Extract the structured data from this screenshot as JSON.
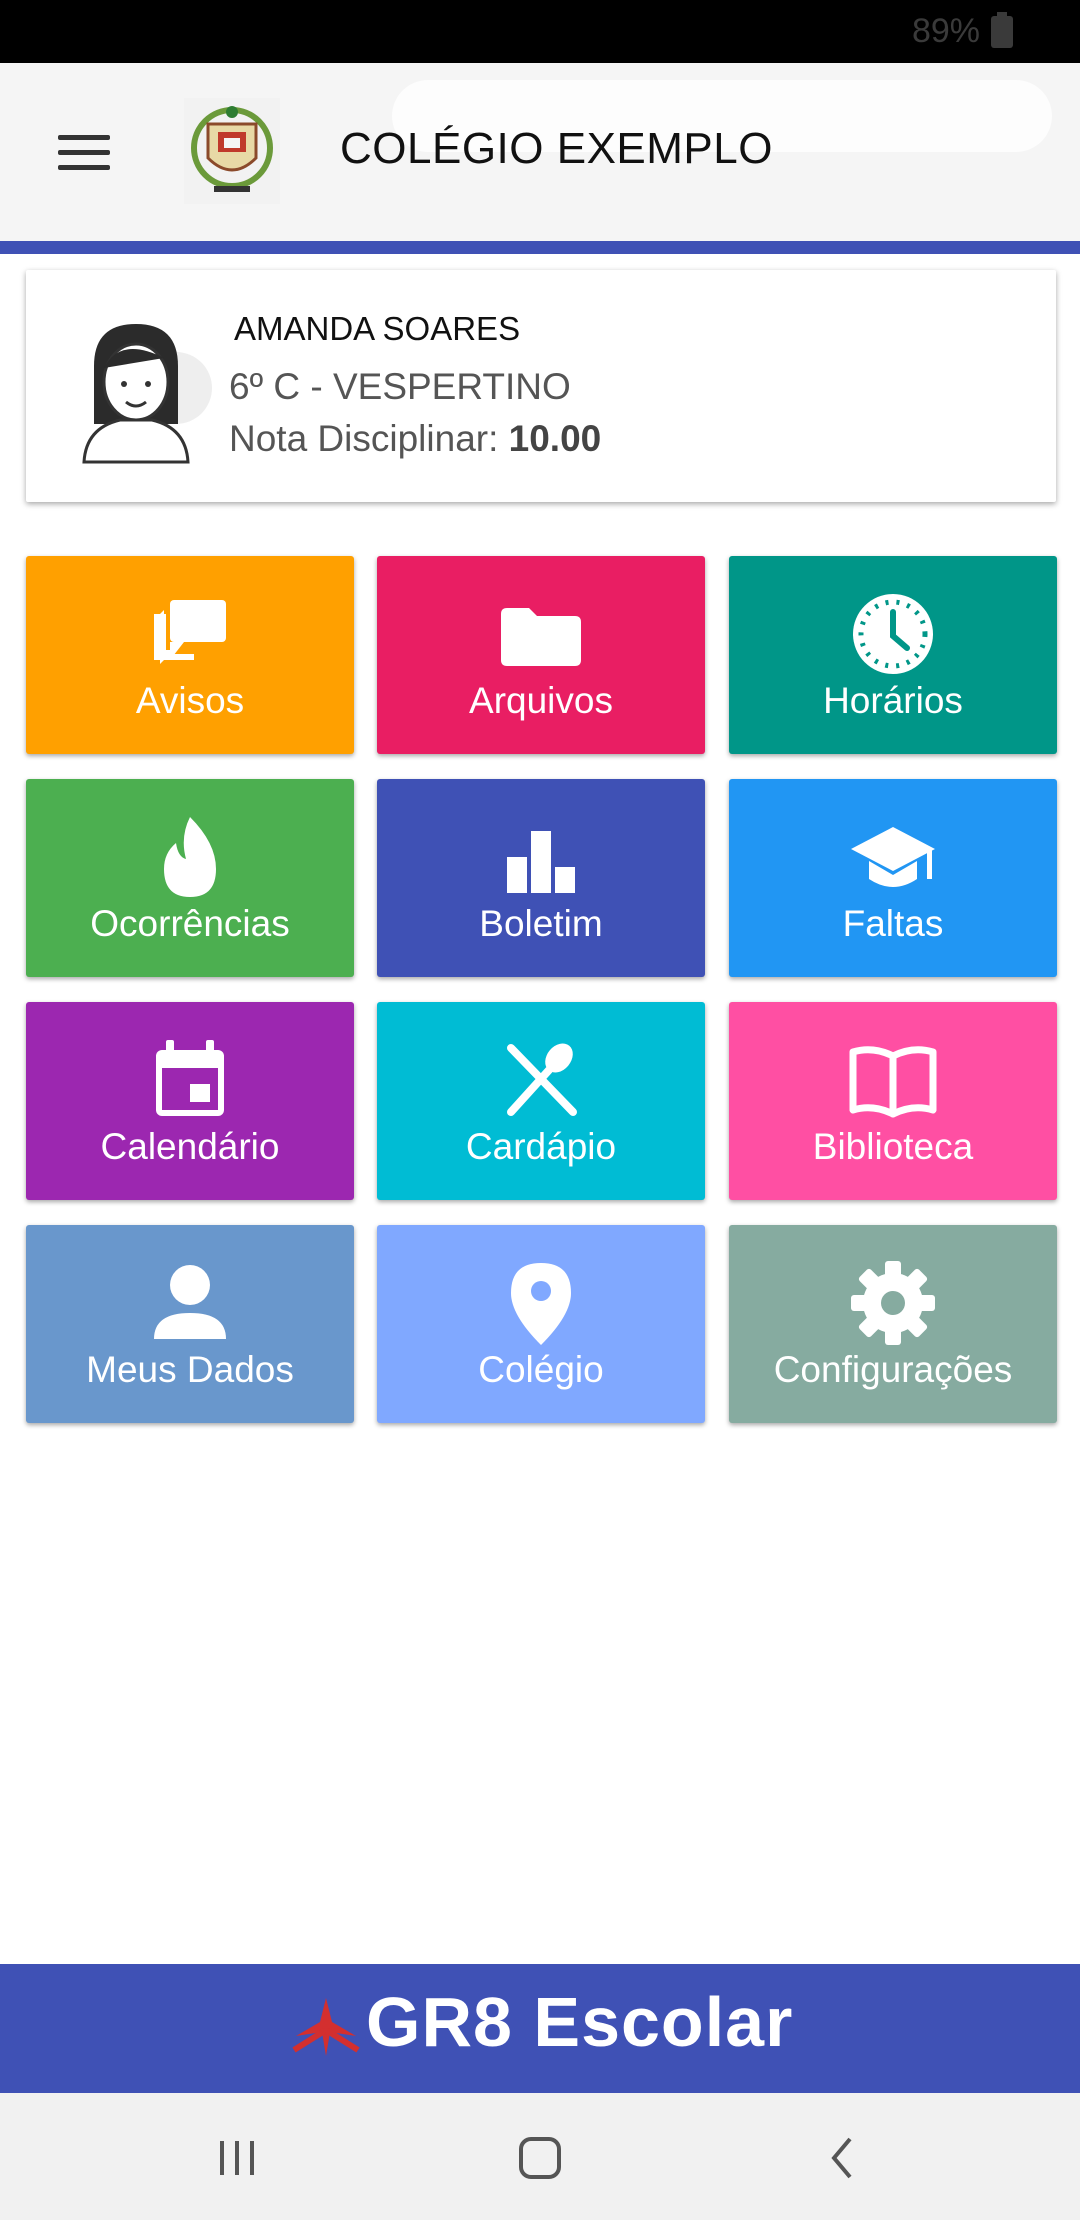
{
  "status": {
    "battery": "89%"
  },
  "header": {
    "title": "COLÉGIO EXEMPLO"
  },
  "student": {
    "name": "AMANDA SOARES",
    "class": "6º C - VESPERTINO",
    "grade_label": "Nota Disciplinar: ",
    "grade_value": "10.00"
  },
  "tiles": [
    {
      "label": "Avisos",
      "icon": "chat-icon",
      "color": "#ffa000"
    },
    {
      "label": "Arquivos",
      "icon": "folder-icon",
      "color": "#e91e63"
    },
    {
      "label": "Horários",
      "icon": "clock-icon",
      "color": "#009688"
    },
    {
      "label": "Ocorrências",
      "icon": "flame-icon",
      "color": "#4caf50"
    },
    {
      "label": "Boletim",
      "icon": "chart-icon",
      "color": "#3f51b5"
    },
    {
      "label": "Faltas",
      "icon": "school-cap-icon",
      "color": "#2196f3"
    },
    {
      "label": "Calendário",
      "icon": "calendar-icon",
      "color": "#9c27b0"
    },
    {
      "label": "Cardápio",
      "icon": "utensils-icon",
      "color": "#00bcd4"
    },
    {
      "label": "Biblioteca",
      "icon": "book-icon",
      "color": "#ff4fa3"
    },
    {
      "label": "Meus Dados",
      "icon": "person-icon",
      "color": "#6997cc"
    },
    {
      "label": "Colégio",
      "icon": "location-pin-icon",
      "color": "#80a8ff"
    },
    {
      "label": "Configurações",
      "icon": "gear-icon",
      "color": "#86aba0"
    }
  ],
  "footer": {
    "brand": "GR8 Escolar"
  }
}
